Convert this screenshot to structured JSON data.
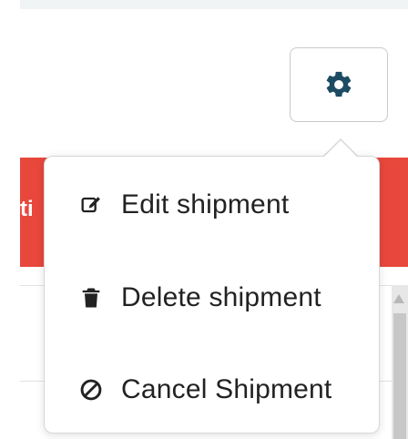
{
  "colors": {
    "accent_red": "#e8473c",
    "gear_blue": "#1d4b64",
    "menu_border": "#d7d7d7",
    "menu_text": "#222222"
  },
  "header": {
    "settings_button_icon": "gear-icon"
  },
  "background": {
    "banner_text": "ti"
  },
  "menu": {
    "items": [
      {
        "label": "Edit shipment",
        "icon": "edit-icon"
      },
      {
        "label": "Delete shipment",
        "icon": "trash-icon"
      },
      {
        "label": "Cancel Shipment",
        "icon": "ban-icon"
      }
    ]
  }
}
